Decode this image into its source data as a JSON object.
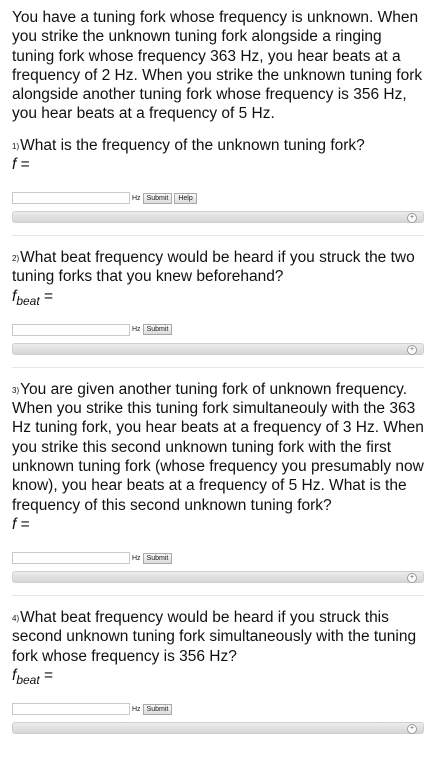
{
  "intro": "You have a tuning fork whose frequency is unknown. When you strike the unknown tuning fork alongside a ringing tuning fork whose frequency 363 Hz, you hear beats at a frequency of 2 Hz. When you strike the unknown tuning fork alongside another tuning fork whose frequency is 356 Hz, you hear beats at a frequency of 5 Hz.",
  "questions": [
    {
      "num": "1)",
      "text": "What is the frequency of the unknown tuning fork?",
      "var": "f",
      "sub": "",
      "eq": " =",
      "unit": "Hz",
      "submit": "Submit",
      "help": "Help"
    },
    {
      "num": "2)",
      "text": "What beat frequency would be heard if you struck the two tuning forks that you knew beforehand?",
      "var": "f",
      "sub": "beat",
      "eq": " =",
      "unit": "Hz",
      "submit": "Submit"
    },
    {
      "num": "3)",
      "text": "You are given another tuning fork of unknown frequency. When you strike this tuning fork simultaneouly with the 363 Hz tuning fork, you hear beats at a frequency of 3 Hz. When you strike this second unknown tuning fork with the first unknown tuning fork (whose frequency you presumably now know), you hear beats at a frequency of 5 Hz. What is the frequency of this second unknown tuning fork?",
      "var": "f",
      "sub": "",
      "eq": " =",
      "unit": "Hz",
      "submit": "Submit"
    },
    {
      "num": "4)",
      "text": "What beat frequency would be heard if you struck this second unknown tuning fork simultaneously with the tuning fork whose frequency is 356 Hz?",
      "var": "f",
      "sub": "beat",
      "eq": " =",
      "unit": "Hz",
      "submit": "Submit"
    }
  ],
  "icons": {
    "expand": "plus-circle-icon"
  }
}
